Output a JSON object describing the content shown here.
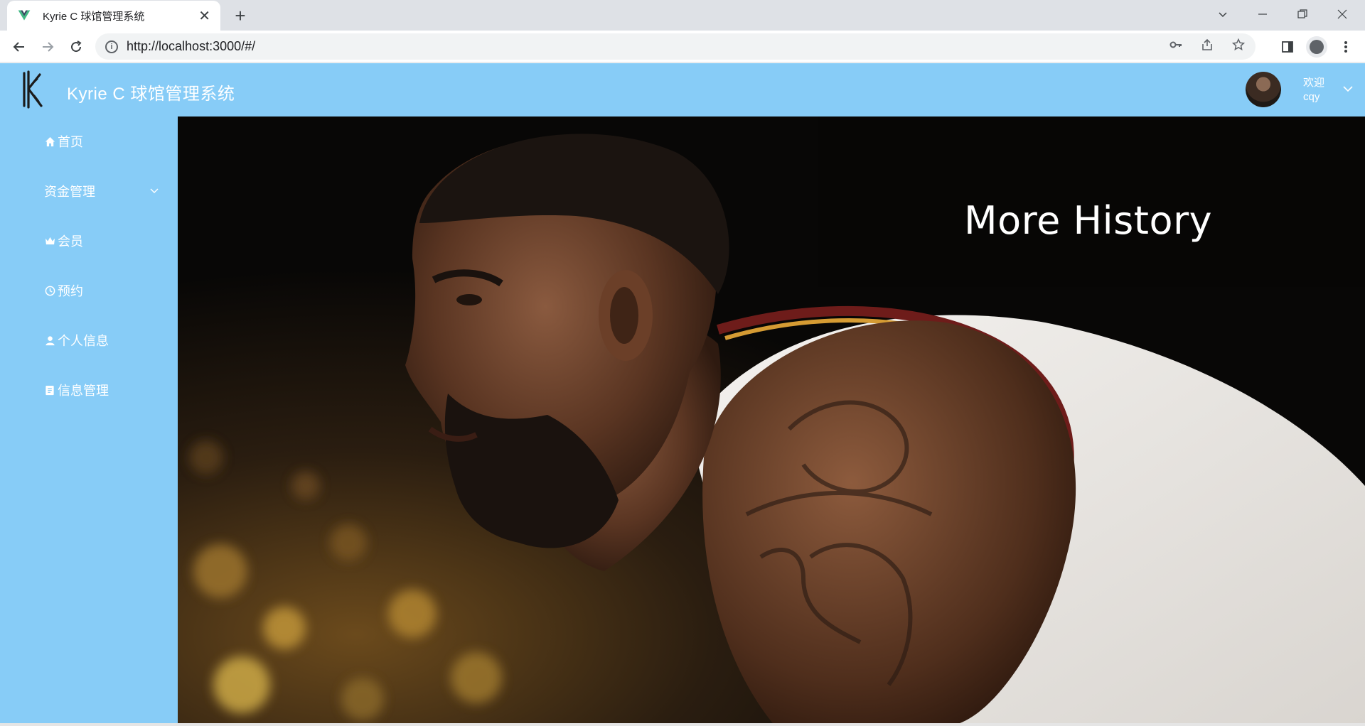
{
  "browser": {
    "tab_title": "Kyrie C 球馆管理系统",
    "url": "http://localhost:3000/#/"
  },
  "header": {
    "title": "Kyrie C 球馆管理系统",
    "welcome": "欢迎",
    "username": "cqy"
  },
  "sidebar": {
    "items": [
      {
        "label": "首页",
        "icon": "home-icon"
      },
      {
        "label": "资金管理",
        "icon": "",
        "has_submenu": true
      },
      {
        "label": "会员",
        "icon": "crown-icon"
      },
      {
        "label": "预约",
        "icon": "clock-icon"
      },
      {
        "label": "个人信息",
        "icon": "user-icon"
      },
      {
        "label": "信息管理",
        "icon": "document-icon"
      }
    ]
  },
  "main": {
    "hero_text": "More History"
  },
  "colors": {
    "accent": "#87ccf7",
    "text_on_accent": "#ffffff"
  }
}
